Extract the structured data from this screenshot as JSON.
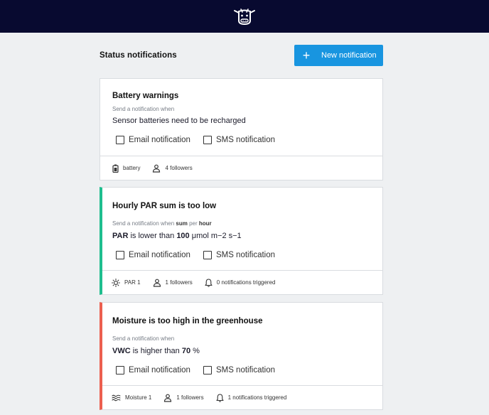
{
  "header": {
    "logo_icon": "cow-logo-icon"
  },
  "page": {
    "section_title": "Status notifications",
    "new_button_icon": "+",
    "new_button_label": "New notification"
  },
  "cards": [
    {
      "title": "Battery warnings",
      "sub_prefix": "Send a notification when",
      "condition": "Sensor batteries need to be recharged",
      "email_label": "Email notification",
      "sms_label": "SMS notification",
      "sensor": "battery",
      "sensor_icon": "battery-icon",
      "followers": "4 followers",
      "accent": null
    },
    {
      "title": "Hourly PAR sum is too low",
      "sub_prefix": "Send a notification when",
      "sub_agg": "sum",
      "sub_mid": "per",
      "sub_period": "hour",
      "cond_metric": "PAR",
      "cond_op": "is lower than",
      "cond_value": "100",
      "cond_unit": "μmol m−2 s−1",
      "email_label": "Email notification",
      "sms_label": "SMS notification",
      "sensor": "PAR 1",
      "sensor_icon": "sun-icon",
      "followers": "1 followers",
      "triggered": "0 notifications triggered",
      "accent": "#1fbe8e"
    },
    {
      "title": "Moisture is too high in the greenhouse",
      "sub_prefix": "Send a notification when",
      "cond_metric": "VWC",
      "cond_op": "is higher than",
      "cond_value": "70",
      "cond_unit": "%",
      "email_label": "Email notification",
      "sms_label": "SMS notification",
      "sensor": "Moisture 1",
      "sensor_icon": "waves-icon",
      "followers": "1 followers",
      "triggered": "1 notifications triggered",
      "accent": "#ec5f4f"
    }
  ],
  "colors": {
    "topbar": "#080a30",
    "primary": "#1895e0",
    "green": "#1fbe8e",
    "red": "#ec5f4f"
  }
}
